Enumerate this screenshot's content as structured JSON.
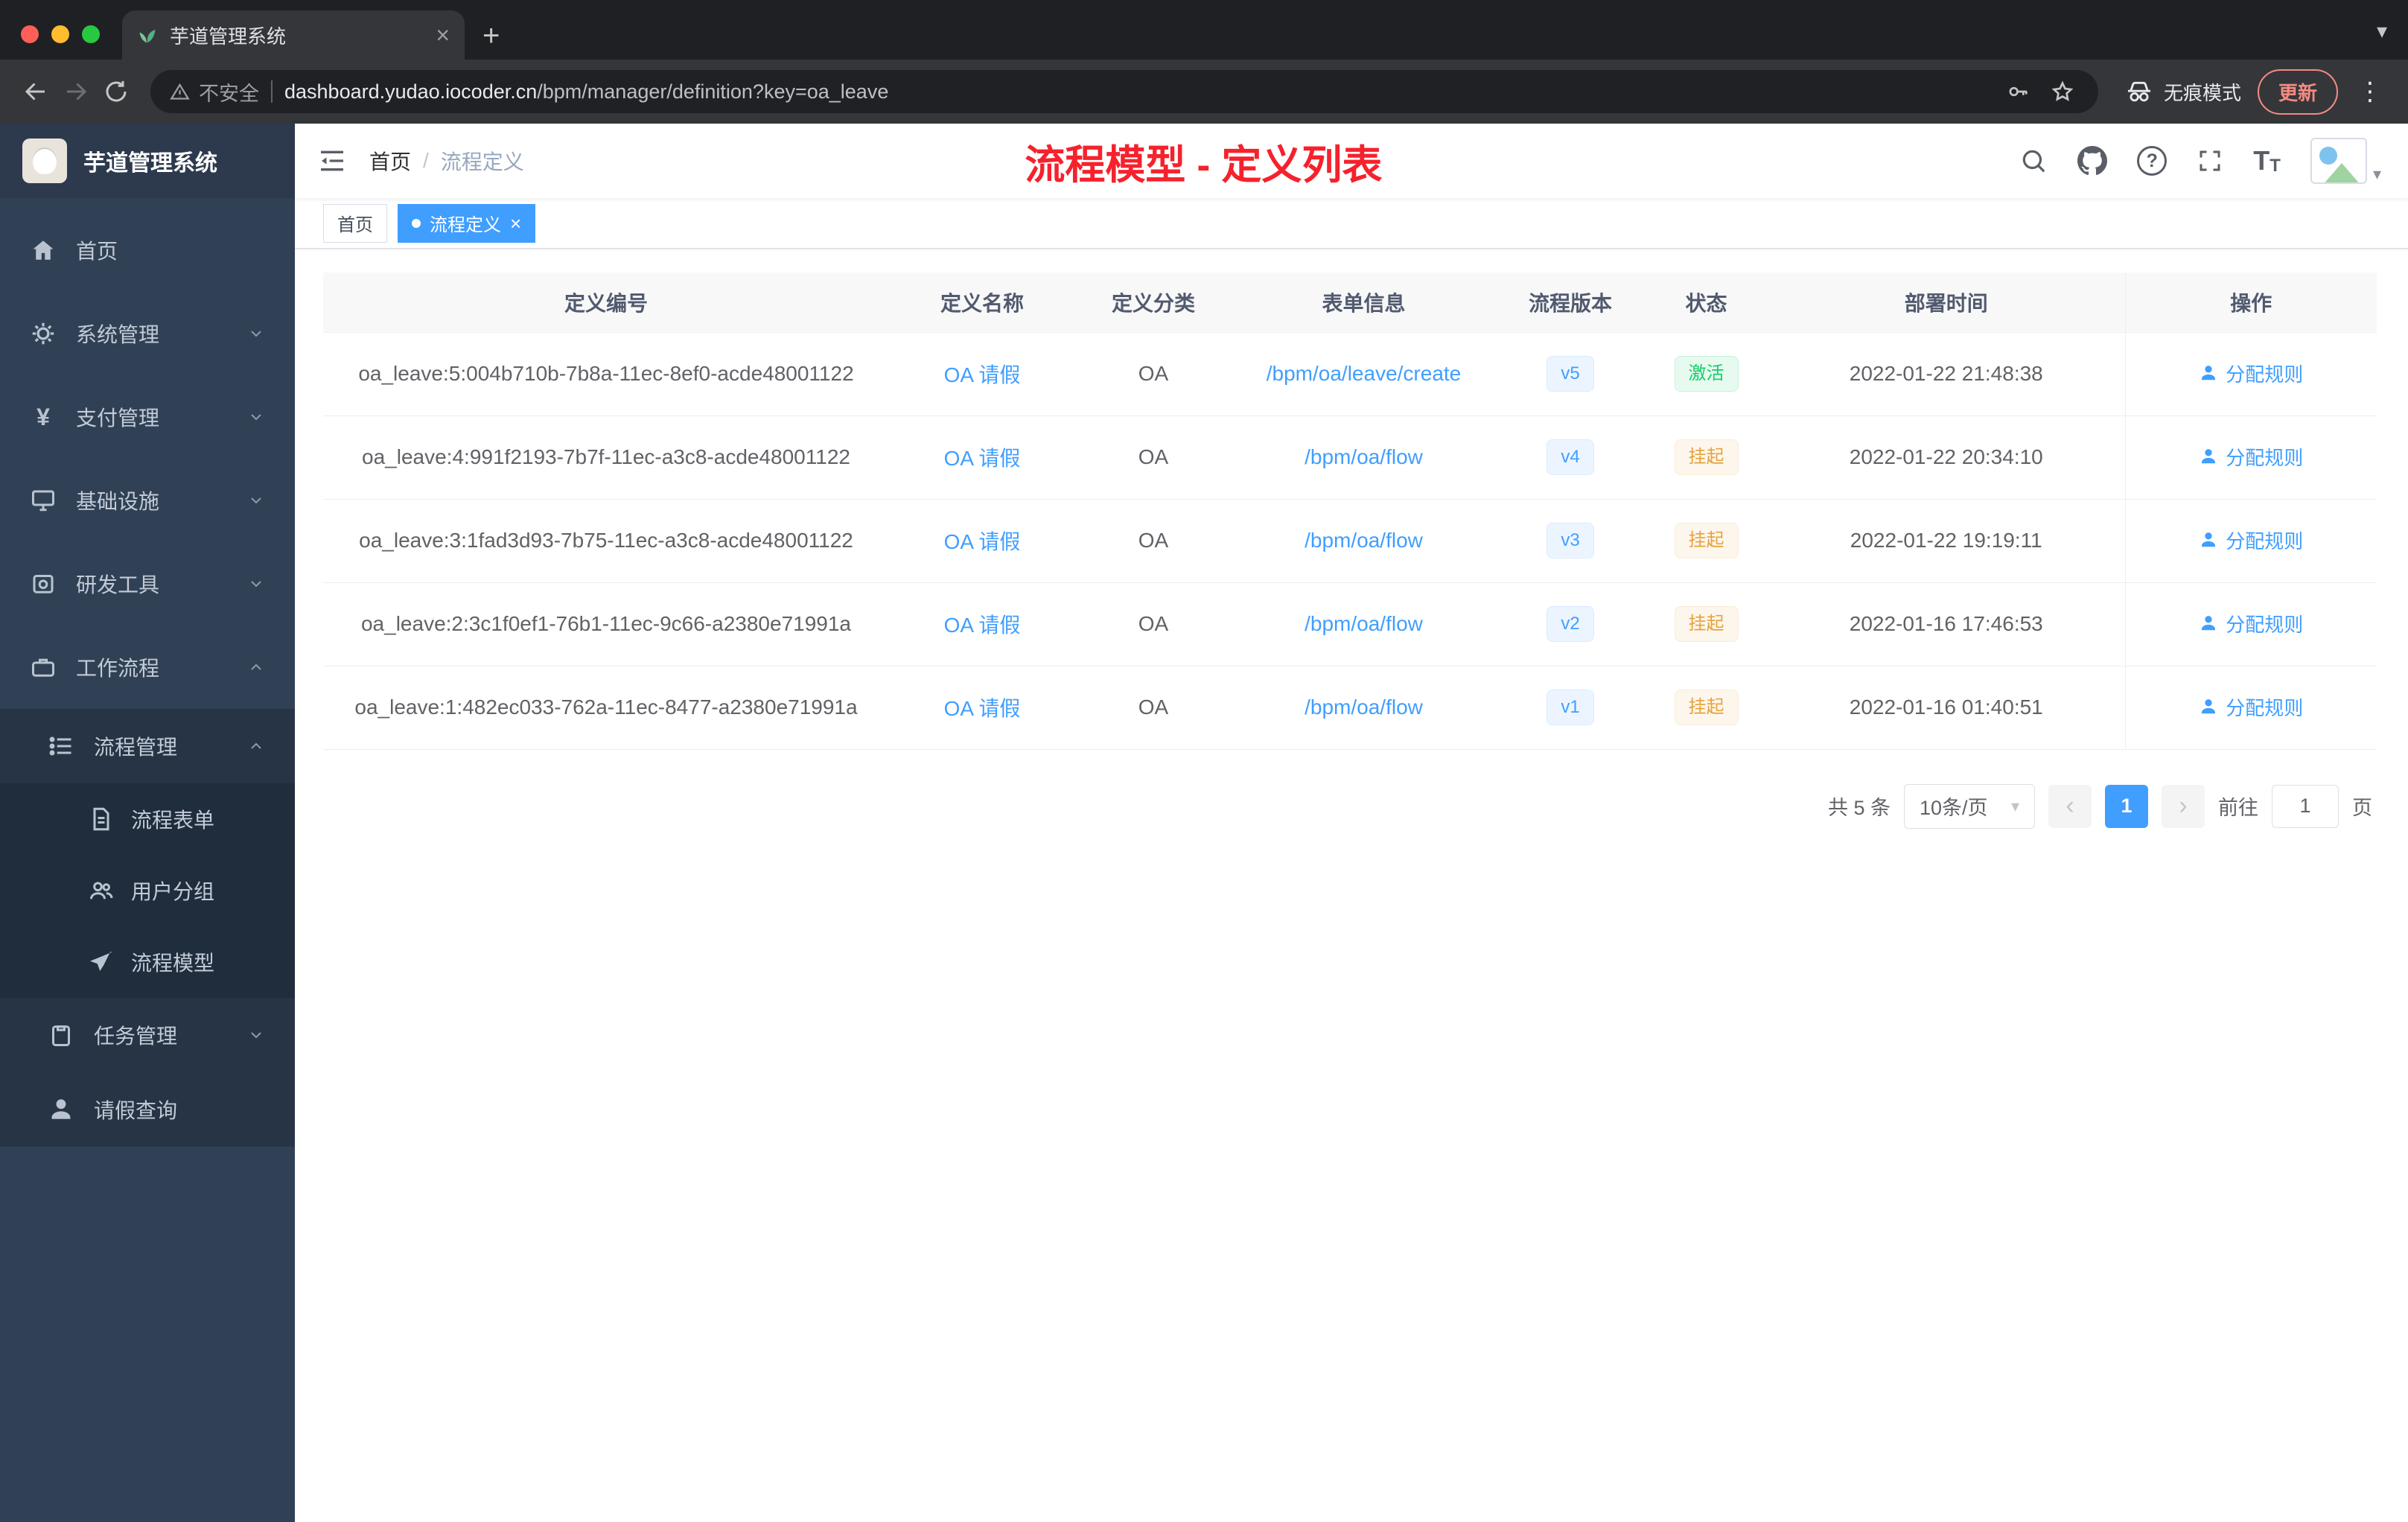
{
  "colors": {
    "accent": "#409eff",
    "title_red": "#f5222d",
    "status_active": "#13ce66",
    "status_suspended": "#e6a23c",
    "sidebar_bg": "#304156"
  },
  "icons": {
    "close": "×",
    "plus": "+",
    "caret_down": "▾",
    "dots": "⋮",
    "question": "?",
    "chevron_left": "‹",
    "chevron_right": "›",
    "font_large": "T",
    "font_small": "T",
    "yen": "¥"
  },
  "browser": {
    "tab_title": "芋道管理系统",
    "security_label": "不安全",
    "url_host": "dashboard.yudao.iocoder.cn",
    "url_path": "/bpm/manager/definition?key=oa_leave",
    "incognito_label": "无痕模式",
    "update_label": "更新"
  },
  "sidebar": {
    "logo_title": "芋道管理系统",
    "items": [
      {
        "label": "首页"
      },
      {
        "label": "系统管理"
      },
      {
        "label": "支付管理"
      },
      {
        "label": "基础设施"
      },
      {
        "label": "研发工具"
      },
      {
        "label": "工作流程"
      },
      {
        "label": "流程管理"
      },
      {
        "label": "流程表单"
      },
      {
        "label": "用户分组"
      },
      {
        "label": "流程模型"
      },
      {
        "label": "任务管理"
      },
      {
        "label": "请假查询"
      }
    ]
  },
  "navbar": {
    "breadcrumb_home": "首页",
    "breadcrumb_separator": "/",
    "breadcrumb_current": "流程定义",
    "overlay_title": "流程模型 - 定义列表"
  },
  "tags": [
    {
      "label": "首页"
    },
    {
      "label": "流程定义"
    }
  ],
  "table": {
    "columns": [
      "定义编号",
      "定义名称",
      "定义分类",
      "表单信息",
      "流程版本",
      "状态",
      "部署时间",
      "操作"
    ],
    "rows": [
      {
        "id": "oa_leave:5:004b710b-7b8a-11ec-8ef0-acde48001122",
        "name": "OA 请假",
        "category": "OA",
        "form": "/bpm/oa/leave/create",
        "version": "v5",
        "status": "激活",
        "status_type": "active",
        "deploy_time": "2022-01-22 21:48:38",
        "action": "分配规则"
      },
      {
        "id": "oa_leave:4:991f2193-7b7f-11ec-a3c8-acde48001122",
        "name": "OA 请假",
        "category": "OA",
        "form": "/bpm/oa/flow",
        "version": "v4",
        "status": "挂起",
        "status_type": "suspended",
        "deploy_time": "2022-01-22 20:34:10",
        "action": "分配规则"
      },
      {
        "id": "oa_leave:3:1fad3d93-7b75-11ec-a3c8-acde48001122",
        "name": "OA 请假",
        "category": "OA",
        "form": "/bpm/oa/flow",
        "version": "v3",
        "status": "挂起",
        "status_type": "suspended",
        "deploy_time": "2022-01-22 19:19:11",
        "action": "分配规则"
      },
      {
        "id": "oa_leave:2:3c1f0ef1-76b1-11ec-9c66-a2380e71991a",
        "name": "OA 请假",
        "category": "OA",
        "form": "/bpm/oa/flow",
        "version": "v2",
        "status": "挂起",
        "status_type": "suspended",
        "deploy_time": "2022-01-16 17:46:53",
        "action": "分配规则"
      },
      {
        "id": "oa_leave:1:482ec033-762a-11ec-8477-a2380e71991a",
        "name": "OA 请假",
        "category": "OA",
        "form": "/bpm/oa/flow",
        "version": "v1",
        "status": "挂起",
        "status_type": "suspended",
        "deploy_time": "2022-01-16 01:40:51",
        "action": "分配规则"
      }
    ]
  },
  "pagination": {
    "total": "共 5 条",
    "page_size": "10条/页",
    "current_page": "1",
    "goto_label": "前往",
    "goto_value": "1",
    "page_unit": "页"
  }
}
